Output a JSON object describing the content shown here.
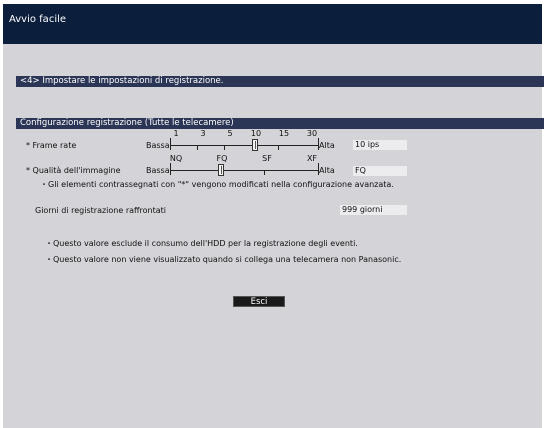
{
  "window": {
    "title": "Avvio facile"
  },
  "step_bar": {
    "label": "<4> Impostare le impostazioni di registrazione."
  },
  "config_bar": {
    "label": "Configurazione registrazione (Tutte le telecamere)"
  },
  "frame_rate": {
    "label": "* Frame rate",
    "low_label": "Bassa",
    "high_label": "Alta",
    "ticks": [
      "1",
      "3",
      "5",
      "10",
      "15",
      "30"
    ],
    "value": "10 ips"
  },
  "quality": {
    "label": "* Qualità dell'immagine",
    "low_label": "Bassa",
    "high_label": "Alta",
    "ticks": [
      "NQ",
      "FQ",
      "SF",
      "XF"
    ],
    "value": "FQ"
  },
  "note_advanced": "・Gli elementi contrassegnati con \"*\" vengono modificati nella configurazione avanzata.",
  "days": {
    "label": "Giorni di registrazione raffrontati",
    "value": "999 giorni"
  },
  "notes": [
    "・Questo valore esclude il consumo dell'HDD per la registrazione degli eventi.",
    "・Questo valore non viene visualizzato quando si collega una telecamera non Panasonic."
  ],
  "exit_button": {
    "label": "Esci"
  }
}
